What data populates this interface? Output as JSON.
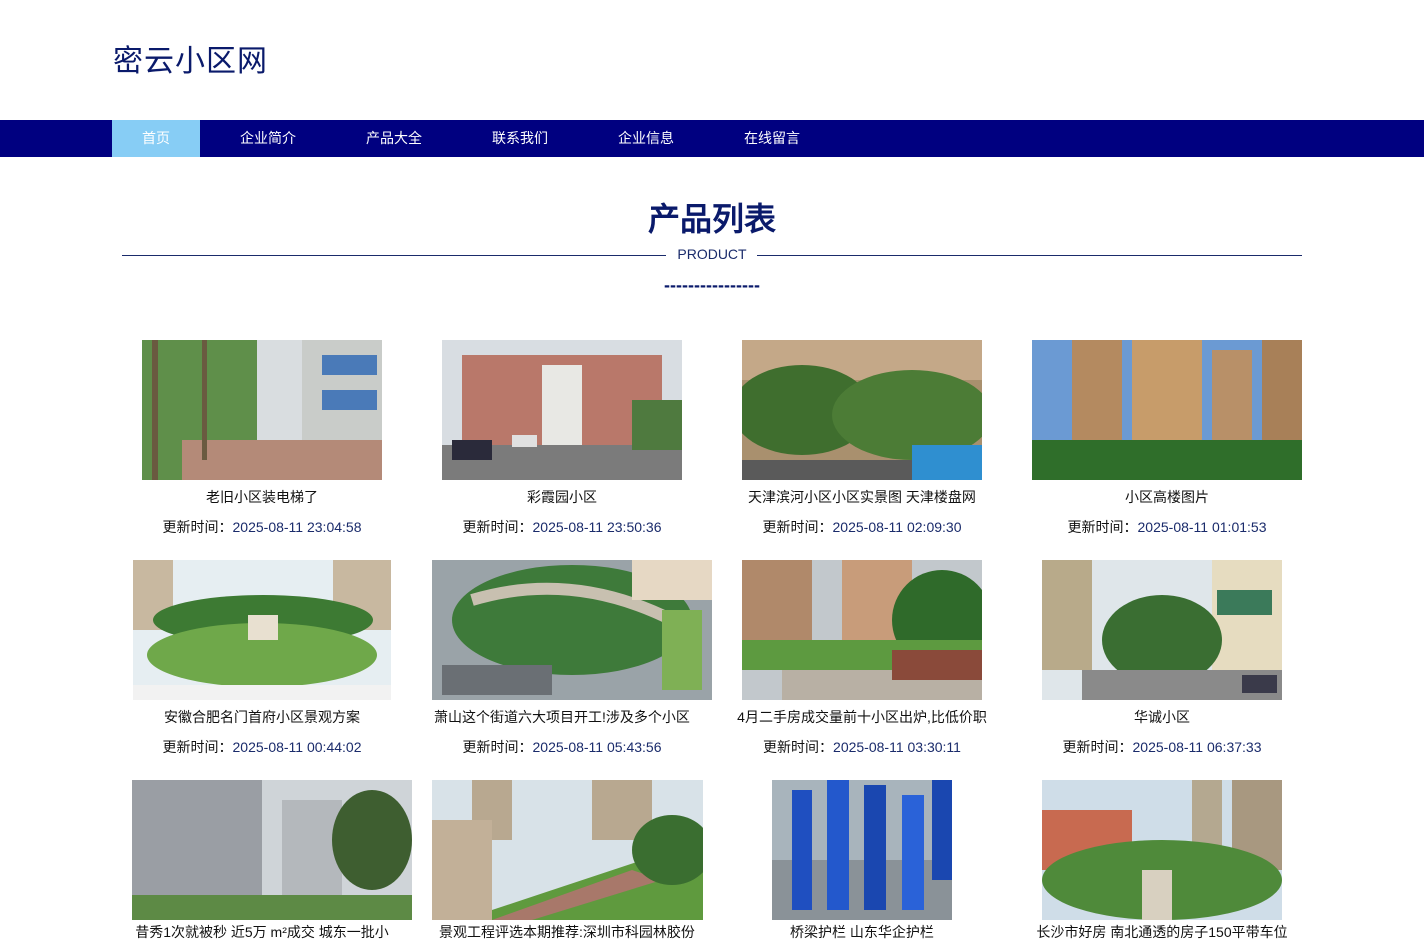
{
  "site": {
    "title": "密云小区网"
  },
  "nav": {
    "items": [
      "首页",
      "企业简介",
      "产品大全",
      "联系我们",
      "企业信息",
      "在线留言"
    ]
  },
  "section": {
    "title": "产品列表",
    "subtitle": "PRODUCT",
    "dash": "----------------"
  },
  "products": [
    {
      "title": "老旧小区装电梯了",
      "time_label": "更新时间：",
      "time": "2025-08-11 23:04:58"
    },
    {
      "title": "彩霞园小区",
      "time_label": "更新时间：",
      "time": "2025-08-11 23:50:36"
    },
    {
      "title": "天津滨河小区小区实景图 天津楼盘网",
      "time_label": "更新时间：",
      "time": "2025-08-11 02:09:30"
    },
    {
      "title": "小区高楼图片",
      "time_label": "更新时间：",
      "time": "2025-08-11 01:01:53"
    },
    {
      "title": "安徽合肥名门首府小区景观方案",
      "time_label": "更新时间：",
      "time": "2025-08-11 00:44:02"
    },
    {
      "title": "萧山这个街道六大项目开工!涉及多个小区",
      "time_label": "更新时间：",
      "time": "2025-08-11 05:43:56"
    },
    {
      "title": "4月二手房成交量前十小区出炉,比低价职",
      "time_label": "更新时间：",
      "time": "2025-08-11 03:30:11"
    },
    {
      "title": "华诚小区",
      "time_label": "更新时间：",
      "time": "2025-08-11 06:37:33"
    },
    {
      "title": "昔秀1次就被秒 近5万 m²成交 城东一批小",
      "time_label": "",
      "time": ""
    },
    {
      "title": "景观工程评选本期推荐:深圳市科园林胶份",
      "time_label": "",
      "time": ""
    },
    {
      "title": "桥梁护栏 山东华企护栏",
      "time_label": "",
      "time": ""
    },
    {
      "title": "长沙市好房 南北通透的房子150平带车位",
      "time_label": "",
      "time": ""
    }
  ],
  "colors": {
    "nav_bg": "#000080",
    "nav_active": "#87cdf5",
    "title": "#0a1a6b"
  }
}
